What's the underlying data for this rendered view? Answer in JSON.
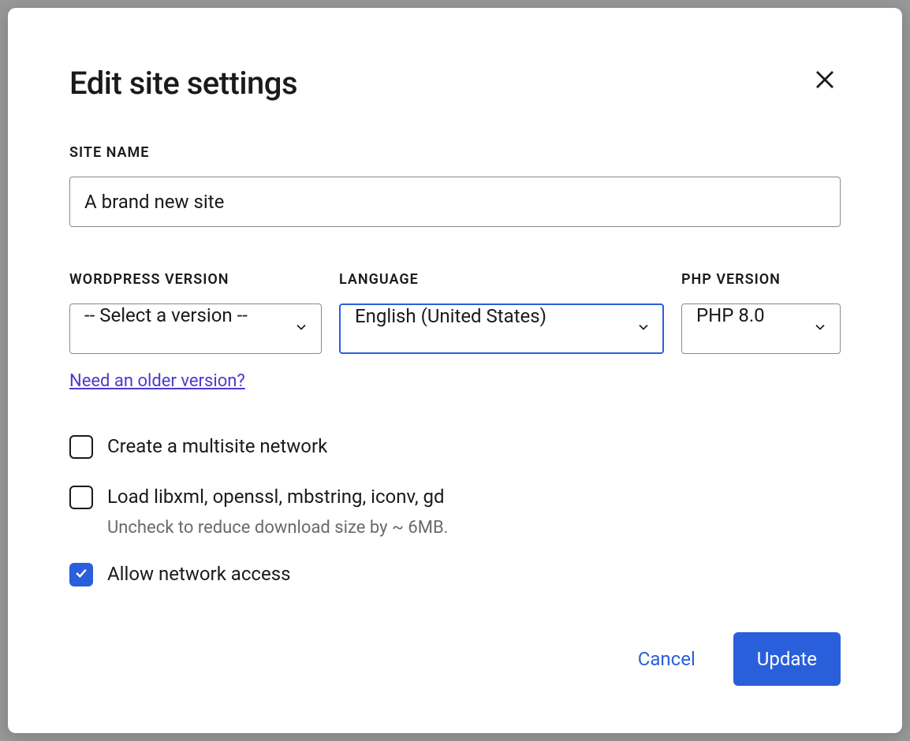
{
  "modal": {
    "title": "Edit site settings",
    "fields": {
      "site_name": {
        "label": "SITE NAME",
        "value": "A brand new site"
      },
      "wp_version": {
        "label": "WORDPRESS VERSION",
        "value": "-- Select a version --",
        "older_link": "Need an older version?"
      },
      "language": {
        "label": "LANGUAGE",
        "value": "English (United States)"
      },
      "php_version": {
        "label": "PHP VERSION",
        "value": "PHP 8.0"
      }
    },
    "checkboxes": {
      "multisite": {
        "label": "Create a multisite network",
        "checked": false
      },
      "extensions": {
        "label": "Load libxml, openssl, mbstring, iconv, gd",
        "help": "Uncheck to reduce download size by ~ 6MB.",
        "checked": false
      },
      "network": {
        "label": "Allow network access",
        "checked": true
      }
    },
    "actions": {
      "cancel": "Cancel",
      "update": "Update"
    }
  }
}
